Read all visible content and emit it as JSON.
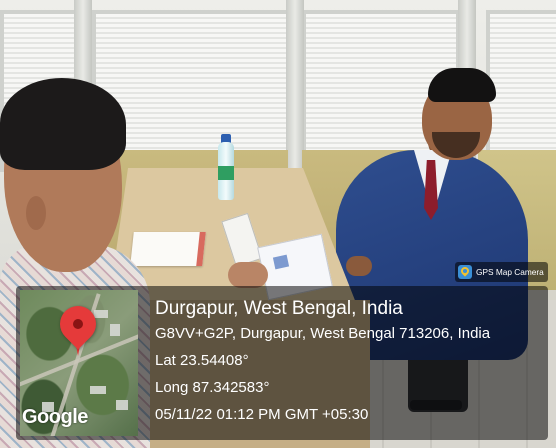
{
  "watermark": {
    "app_name": "GPS Map Camera",
    "app_icon": "gps-map-camera-icon",
    "map_provider": "Google",
    "map_pin": "map-pin-icon"
  },
  "location": {
    "title": "Durgapur, West Bengal, India",
    "address": "G8VV+G2P, Durgapur, West Bengal 713206, India",
    "latitude": "Lat 23.54408°",
    "longitude": "Long 87.342583°",
    "datetime": "05/11/22 01:12 PM GMT +05:30"
  },
  "colors": {
    "overlay": "#000000",
    "pin": "#e53a3a",
    "text": "#ffffff"
  }
}
